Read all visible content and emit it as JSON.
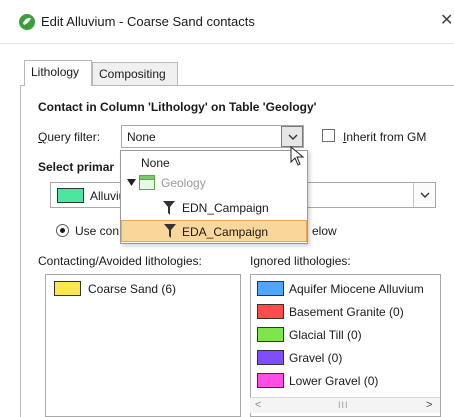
{
  "window": {
    "title": "Edit Alluvium - Coarse Sand contacts",
    "close_glyph": "✕"
  },
  "tabs": [
    {
      "label": "Lithology",
      "active": true
    },
    {
      "label": "Compositing",
      "active": false
    }
  ],
  "contact": {
    "heading": "Contact in Column 'Lithology' on Table 'Geology'",
    "query_filter_label": "Query filter:",
    "query_filter_value": "None",
    "inherit_label": "Inherit from GM",
    "inherit_checked": false
  },
  "primary": {
    "label": "Select primar",
    "value": "Alluviu",
    "swatch_color": "#4de6a0"
  },
  "use_option": {
    "left": "Use con",
    "right": "elow",
    "selected": true
  },
  "dropdown": {
    "items": [
      {
        "label": "None",
        "icon": "",
        "indent": 0
      },
      {
        "label": "Geology",
        "icon": "table-folder-icon",
        "indent": 1,
        "disabled": true
      },
      {
        "label": "EDN_Campaign",
        "icon": "filter-icon",
        "indent": 2
      },
      {
        "label": "EDA_Campaign",
        "icon": "filter-icon",
        "indent": 2,
        "selected": true
      }
    ]
  },
  "lists": {
    "contacting_label": "Contacting/Avoided lithologies:",
    "ignored_label": "Ignored lithologies:",
    "contacting": [
      {
        "name": "Coarse Sand (6)",
        "color": "#ffe64d"
      }
    ],
    "ignored": [
      {
        "name": "Aquifer Miocene Alluvium",
        "color": "#4da6ff"
      },
      {
        "name": "Basement Granite (0)",
        "color": "#ff4d4d"
      },
      {
        "name": "Glacial Till (0)",
        "color": "#7de64d"
      },
      {
        "name": "Gravel (0)",
        "color": "#7d4dff"
      },
      {
        "name": "Lower Gravel (0)",
        "color": "#ff4de6"
      }
    ]
  },
  "scrollbar": {
    "left_glyph": "<",
    "thumb_glyph": "III",
    "right_glyph": ">"
  }
}
